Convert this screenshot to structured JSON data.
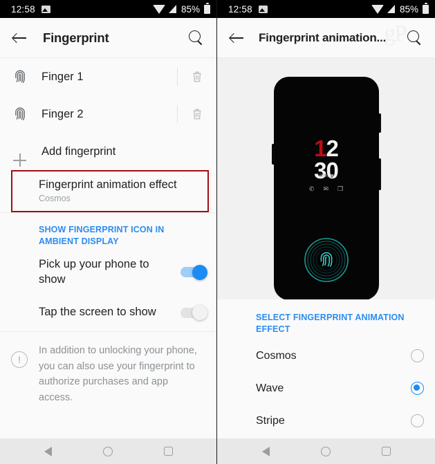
{
  "status_bar": {
    "time": "12:58",
    "battery_percent": "85%",
    "icons": [
      "screenshot-icon",
      "wifi-icon",
      "signal-icon",
      "battery-icon"
    ]
  },
  "left_screen": {
    "appbar": {
      "title": "Fingerprint",
      "back_icon": "back-arrow-icon",
      "search_icon": "search-icon"
    },
    "fingerprints": [
      {
        "label": "Finger 1",
        "icon": "fingerprint-icon",
        "delete_icon": "trash-icon"
      },
      {
        "label": "Finger 2",
        "icon": "fingerprint-icon",
        "delete_icon": "trash-icon"
      }
    ],
    "add_row": {
      "label": "Add fingerprint",
      "icon": "plus-icon"
    },
    "animation_effect": {
      "title": "Fingerprint animation effect",
      "value": "Cosmos",
      "highlight_color": "#a30b12"
    },
    "ambient_section": {
      "header": "SHOW FINGERPRINT ICON IN AMBIENT DISPLAY",
      "header_color": "#2b8cf0",
      "toggles": [
        {
          "label": "Pick up your phone to show",
          "state": "on"
        },
        {
          "label": "Tap the screen to show",
          "state": "off"
        }
      ]
    },
    "note": {
      "icon": "info-icon",
      "glyph": "!",
      "text": "In addition to unlocking your phone, you can also use your fingerprint to authorize purchases and app access."
    }
  },
  "right_screen": {
    "appbar": {
      "title": "Fingerprint animation...",
      "back_icon": "back-arrow-icon",
      "search_icon": "search-icon",
      "watermark": "gP"
    },
    "preview": {
      "clock_hour_first": "1",
      "clock_hour_rest": "2",
      "clock_minutes": "30",
      "hour_first_color": "#c00a14",
      "battery": "80%",
      "notification_icons": [
        "phone-icon",
        "mail-icon",
        "message-icon"
      ],
      "notification_glyphs": [
        "✆",
        "✉",
        "❐"
      ],
      "animation_icon": "fingerprint-animation-icon",
      "animation_color": "#1fb3ad"
    },
    "options_section": {
      "header": "SELECT FINGERPRINT ANIMATION EFFECT",
      "header_color": "#2b8cf0",
      "options": [
        {
          "label": "Cosmos",
          "selected": false
        },
        {
          "label": "Wave",
          "selected": true
        },
        {
          "label": "Stripe",
          "selected": false
        }
      ]
    }
  },
  "nav_bar": {
    "back": "nav-back-icon",
    "home": "nav-home-icon",
    "recents": "nav-recents-icon"
  }
}
